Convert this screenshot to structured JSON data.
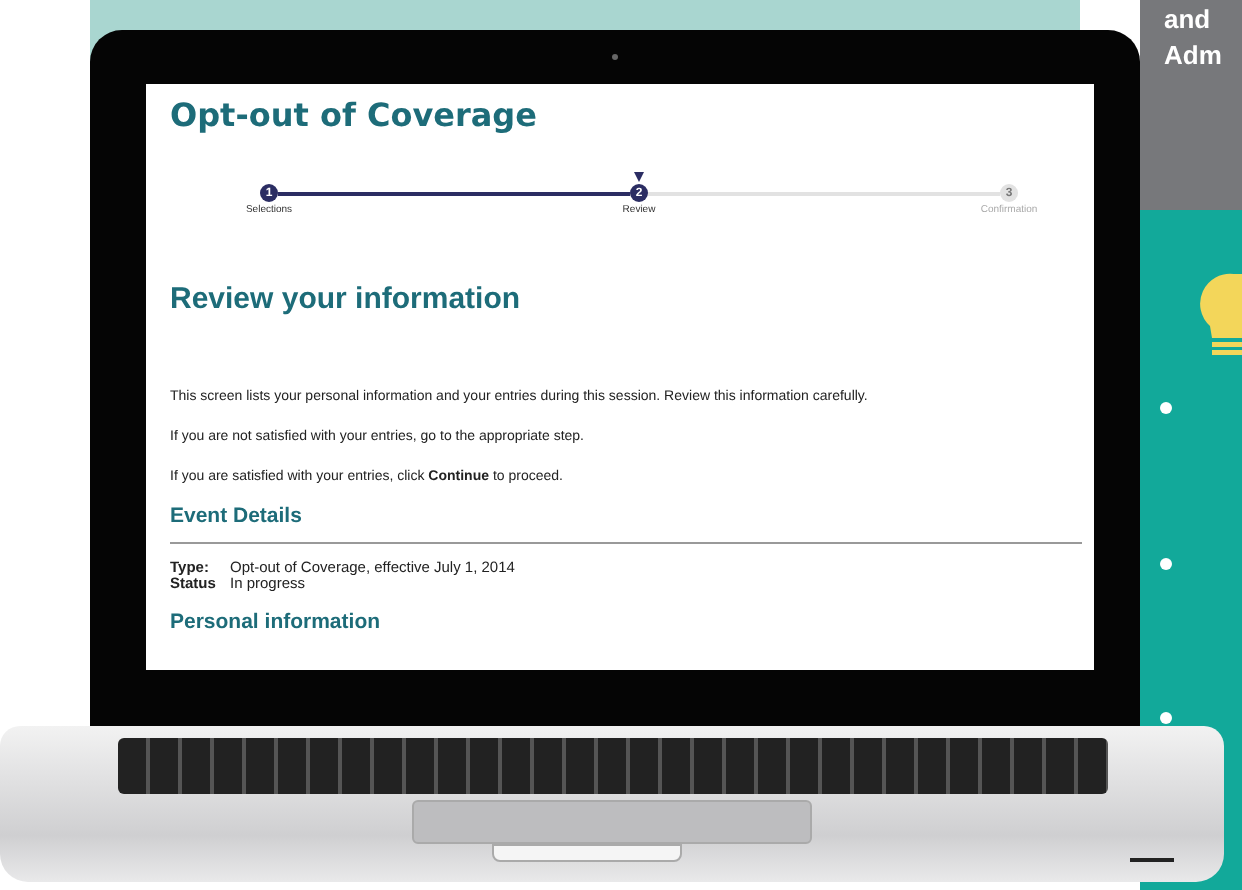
{
  "side_panel": {
    "heading_lines": [
      "and",
      "Adm"
    ]
  },
  "screen": {
    "title": "Opt-out of Coverage",
    "steps": [
      {
        "number": "1",
        "label": "Selections",
        "reached": true,
        "selected": false
      },
      {
        "number": "2",
        "label": "Review",
        "reached": true,
        "selected": true
      },
      {
        "number": "3",
        "label": "Confirmation",
        "reached": false,
        "selected": false
      }
    ],
    "heading": "Review your information",
    "paragraphs": [
      "This screen lists your personal information and your entries during this session. Review this information carefully.",
      "If you are not satisfied with your entries, go to the appropriate step.",
      "If you are satisfied with your entries, click **Continue** to proceed."
    ],
    "event_details": {
      "title": "Event Details",
      "rows": [
        {
          "label": "Type:",
          "value": "Opt-out of Coverage, effective July 1, 2014"
        },
        {
          "label": "Status",
          "value": "In progress"
        }
      ]
    },
    "personal_title": "Personal information"
  }
}
